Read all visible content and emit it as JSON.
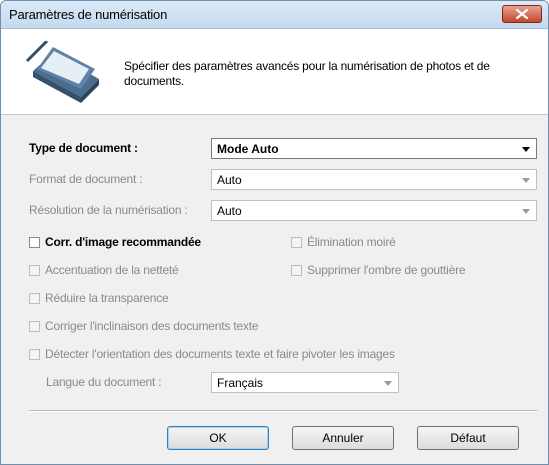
{
  "window": {
    "title": "Paramètres de numérisation"
  },
  "header": {
    "description": "Spécifier des paramètres avancés pour la numérisation de photos et de documents."
  },
  "form": {
    "document_type": {
      "label": "Type de document :",
      "value": "Mode Auto"
    },
    "document_format": {
      "label": "Format de document :",
      "value": "Auto"
    },
    "scan_resolution": {
      "label": "Résolution de la numérisation :",
      "value": "Auto"
    },
    "document_language": {
      "label": "Langue du document :",
      "value": "Français"
    }
  },
  "checkboxes": {
    "image_correction": "Corr. d'image recommandée",
    "moire_reduction": "Élimination moiré",
    "sharpening": "Accentuation de la netteté",
    "gutter_shadow": "Supprimer l'ombre de gouttière",
    "reduce_show_through": "Réduire la transparence",
    "correct_skew": "Corriger l'inclinaison des documents texte",
    "detect_orientation": "Détecter l'orientation des documents texte et faire pivoter les images"
  },
  "buttons": {
    "ok": "OK",
    "cancel": "Annuler",
    "default": "Défaut"
  },
  "icons": {
    "close": "close-icon",
    "scanner": "scanner-icon"
  },
  "colors": {
    "title_bar": "#c6d9ef",
    "close_button": "#c4472a",
    "default_button_border": "#3c7fb1"
  }
}
